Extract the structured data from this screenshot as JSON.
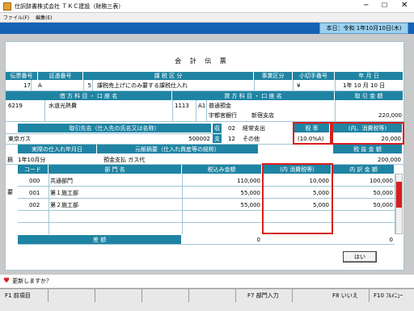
{
  "window": {
    "title": "仕訳辞書株式会社 ＴＫＣ建設（財務三表）",
    "menu": [
      "ファイル(F)",
      "編集(E)"
    ],
    "date_bar": "本日：令和 1年10月10日(木)"
  },
  "voucher": {
    "title": "会 計 伝 票",
    "row1_headers": [
      "伝票番号",
      "証憑番号",
      "課 税 区 分",
      "事業区分",
      "小切手番号",
      "年 月 日"
    ],
    "row1": {
      "voucher_no": "17",
      "mark": "A",
      "tax_code": "5",
      "tax_desc": "課税売上げにのみ要する課税仕入れ",
      "yen": "¥",
      "date": "1年 10 月 10 日"
    },
    "debit_header": "借 方 科 目 ・ 口 座 名",
    "credit_header": "貸 方 科 目 ・ 口 座 名",
    "amount_header": "取 引 金 額",
    "debit": {
      "code": "6219",
      "name": "水道光熱費"
    },
    "credit": {
      "code": "1113",
      "sub": "A1",
      "name": "普通預金",
      "bank": "宇都宮銀行",
      "branch": "新宿支店"
    },
    "amount": "220,000",
    "partner_header": "取引先名（仕入先の氏名又は名称）",
    "partner_name": "東京ガス",
    "partner_code": "500002",
    "shu_label": "収",
    "shi_label": "支",
    "exp1_code": "02",
    "exp1_name": "経常支出",
    "exp2_code": "12",
    "exp2_name": "その他",
    "rate_header": "税 率",
    "rate_value": "(10.0%A)",
    "tax_header": "(内、消費税等)",
    "tax_value": "20,000",
    "purchase_date_header": "実際の仕入れ年月日",
    "summary_header": "元帳摘要（仕入れ資産等の総称）",
    "net_header": "税 抜 金 額",
    "teki_label": "摘",
    "purchase_date": "1年10月分",
    "summary": "預金支払  ガス代",
    "net_amount": "200,000",
    "split_headers": [
      "コード",
      "部 門 名",
      "税込み金額",
      "(内 消費税等)",
      "内 訳 金 額"
    ],
    "side_label": "要",
    "split_rows": [
      {
        "code": "000",
        "name": "共通部門",
        "gross": "110,000",
        "tax": "10,000",
        "net": "100,000"
      },
      {
        "code": "001",
        "name": "第１施工部",
        "gross": "55,000",
        "tax": "5,000",
        "net": "50,000"
      },
      {
        "code": "002",
        "name": "第２施工部",
        "gross": "55,000",
        "tax": "5,000",
        "net": "50,000"
      }
    ],
    "diff_label": "差 額",
    "diff_value": "0",
    "diff_value2": "0",
    "ok_button": "はい"
  },
  "prompt": "更新しますか？",
  "fkeys": [
    "F1 前項目",
    "F7 部門入力",
    "F8 いいえ",
    "F10 ﾌﾙﾒﾆｭｰ"
  ],
  "colors": {
    "header": "#1f84a3",
    "highlight": "#d81e1e",
    "datebar": "#1462b6"
  }
}
